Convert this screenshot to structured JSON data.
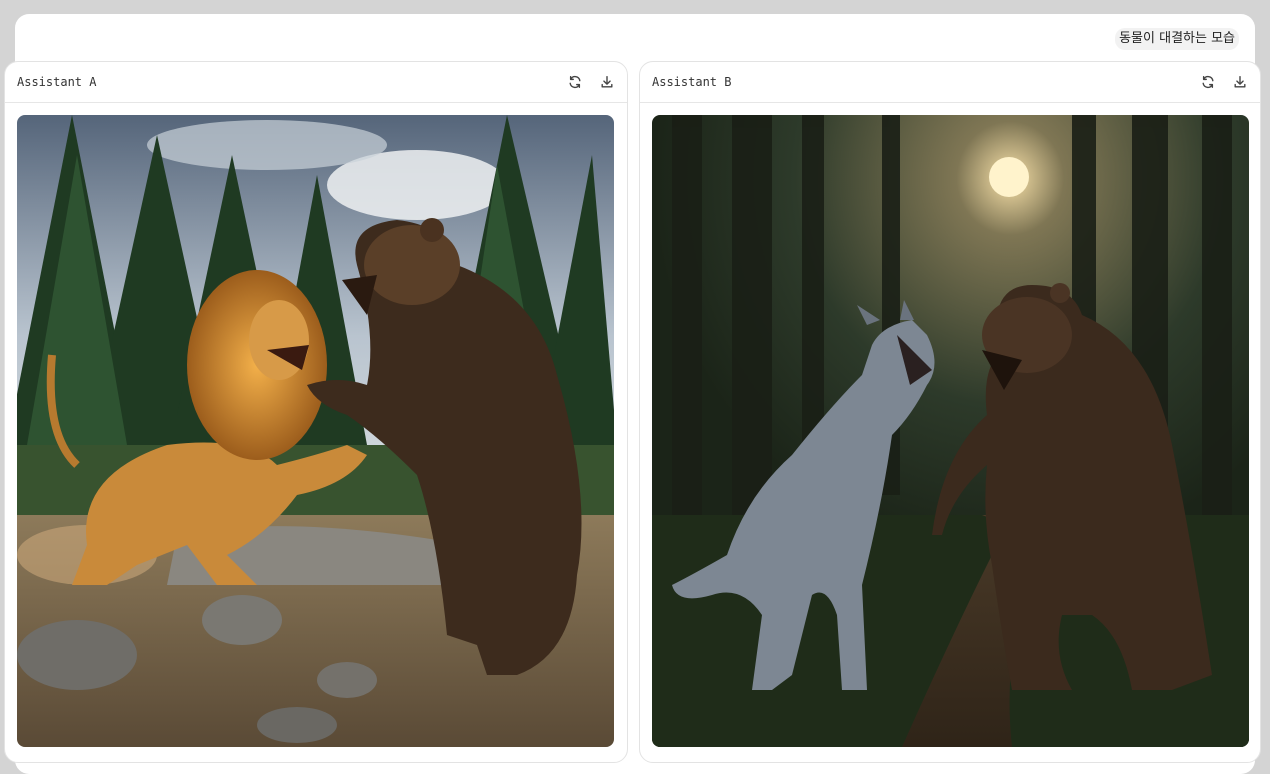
{
  "prompt": {
    "text": "동물이 대결하는 모습"
  },
  "panels": [
    {
      "title": "Assistant A",
      "image_description_icon": "lion-vs-bear-image"
    },
    {
      "title": "Assistant B",
      "image_description_icon": "wolf-vs-bear-image"
    }
  ],
  "actions": {
    "regenerate_icon": "refresh-icon",
    "download_icon": "download-icon"
  }
}
